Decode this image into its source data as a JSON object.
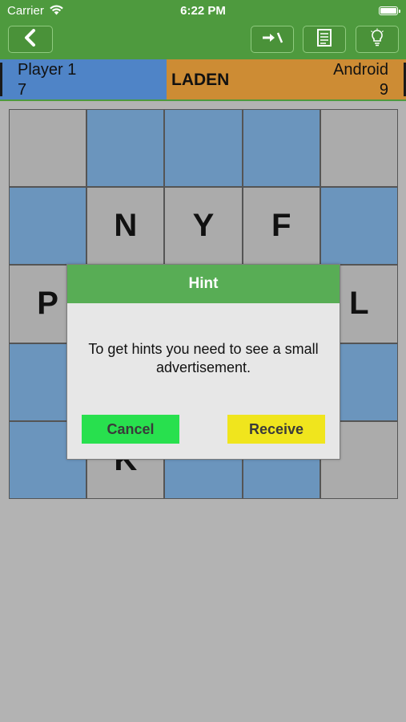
{
  "status_bar": {
    "carrier": "Carrier",
    "time": "6:22 PM"
  },
  "toolbar": {
    "back_icon": "chevron-left-icon",
    "swap_icon": "swap-arrows-icon",
    "notes_icon": "notepad-icon",
    "hint_icon": "lightbulb-icon"
  },
  "score": {
    "player_name": "Player 1",
    "player_score": "7",
    "current_word": "LADEN",
    "opponent_name": "Android",
    "opponent_score": "9"
  },
  "board": {
    "cells": [
      {
        "letter": "",
        "color": "grey"
      },
      {
        "letter": "",
        "color": "blue"
      },
      {
        "letter": "",
        "color": "blue"
      },
      {
        "letter": "",
        "color": "blue"
      },
      {
        "letter": "",
        "color": "grey"
      },
      {
        "letter": "",
        "color": "blue"
      },
      {
        "letter": "N",
        "color": "grey"
      },
      {
        "letter": "Y",
        "color": "grey"
      },
      {
        "letter": "F",
        "color": "grey"
      },
      {
        "letter": "",
        "color": "blue"
      },
      {
        "letter": "P",
        "color": "grey"
      },
      {
        "letter": "",
        "color": "grey"
      },
      {
        "letter": "",
        "color": "grey"
      },
      {
        "letter": "",
        "color": "grey"
      },
      {
        "letter": "L",
        "color": "grey"
      },
      {
        "letter": "",
        "color": "blue"
      },
      {
        "letter": "",
        "color": "grey"
      },
      {
        "letter": "",
        "color": "grey"
      },
      {
        "letter": "",
        "color": "grey"
      },
      {
        "letter": "",
        "color": "blue"
      },
      {
        "letter": "",
        "color": "blue"
      },
      {
        "letter": "K",
        "color": "grey"
      },
      {
        "letter": "",
        "color": "blue"
      },
      {
        "letter": "",
        "color": "blue"
      },
      {
        "letter": "",
        "color": "grey"
      }
    ]
  },
  "dialog": {
    "title": "Hint",
    "message": "To get hints you need to see a small advertisement.",
    "cancel_label": "Cancel",
    "receive_label": "Receive"
  },
  "colors": {
    "header_green": "#4e9a3e",
    "player_blue": "#4f84c7",
    "opponent_orange": "#cd8c34",
    "tile_grey": "#ababab",
    "tile_blue": "#6b95bd",
    "cancel_green": "#28e04e",
    "receive_yellow": "#f0e51d"
  }
}
